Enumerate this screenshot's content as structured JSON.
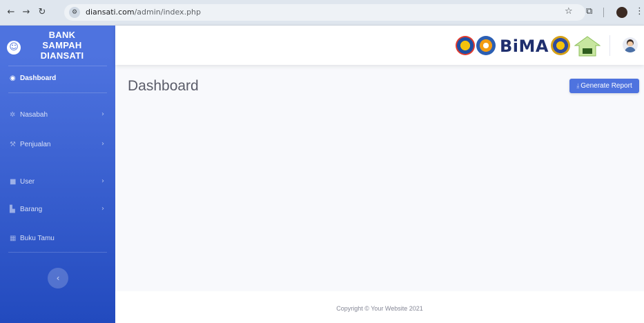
{
  "browser": {
    "url_domain": "diansati.com",
    "url_path": "/admin/index.php"
  },
  "sidebar": {
    "brand_line1": "BANK",
    "brand_line2": "SAMPAH",
    "brand_line3": "DIANSATI",
    "items": [
      {
        "label": "Dashboard",
        "icon": "tachometer-icon"
      },
      {
        "label": "Nasabah",
        "icon": "cog-icon"
      },
      {
        "label": "Penjualan",
        "icon": "wrench-icon"
      },
      {
        "label": "User",
        "icon": "folder-icon"
      },
      {
        "label": "Barang",
        "icon": "chart-area-icon"
      },
      {
        "label": "Buku Tamu",
        "icon": "table-icon"
      }
    ],
    "toggle_glyph": "‹"
  },
  "topbar": {
    "logo_text": "BiMA"
  },
  "content": {
    "page_title": "Dashboard",
    "report_button": "Generate Report"
  },
  "footer": {
    "copyright": "Copyright © Your Website 2021"
  },
  "colors": {
    "primary": "#4e73df",
    "primary_dark": "#224abe",
    "text_muted": "#5a5c69"
  }
}
